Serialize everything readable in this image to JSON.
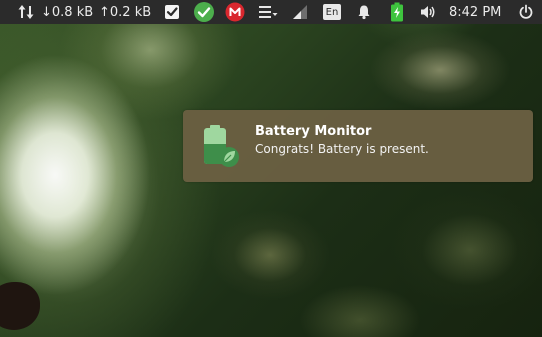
{
  "top_panel": {
    "network_indicator": {
      "icon": "updown-arrows-icon",
      "download_text": "↓0.8 kB",
      "upload_text": "↑0.2 kB"
    },
    "tray_icons": [
      "checkbox-icon",
      "green-check-icon",
      "mega-icon",
      "menu-icon",
      "signal-icon"
    ],
    "keyboard_layout": "En",
    "notification_icon": "bell-icon",
    "battery_icon": "battery-charging-icon",
    "volume_icon": "speaker-icon",
    "clock": "8:42 PM",
    "power_icon": "power-icon"
  },
  "notification": {
    "icon": "battery-leaf-icon",
    "title": "Battery Monitor",
    "body": "Congrats! Battery is present."
  },
  "colors": {
    "panel_bg": "#2b2b2b",
    "notification_bg": "#6c6042",
    "battery_green": "#3ec43e",
    "mega_red": "#d9272e",
    "check_green": "#4cae4c"
  }
}
